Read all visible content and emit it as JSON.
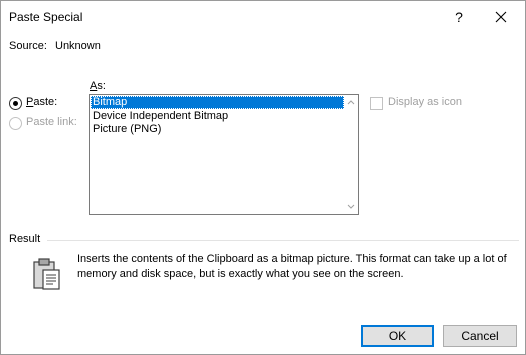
{
  "window": {
    "title": "Paste Special"
  },
  "titlebar": {
    "help_label": "?",
    "close_icon": "close-icon"
  },
  "source": {
    "label": "Source:",
    "value": "Unknown"
  },
  "options": {
    "paste_label": "Paste:",
    "paste_checked": true,
    "paste_link_label": "Paste link:",
    "paste_link_enabled": false
  },
  "as": {
    "label": "As:",
    "items": [
      "Bitmap",
      "Device Independent Bitmap",
      "Picture (PNG)"
    ],
    "selected": "Bitmap"
  },
  "display_as_icon": {
    "label": "Display as icon",
    "checked": false,
    "enabled": false
  },
  "result": {
    "label": "Result",
    "icon": "clipboard-icon",
    "text": "Inserts the contents of the Clipboard as a bitmap picture. This format can take up a lot of memory and disk space, but is exactly what you see on the screen."
  },
  "buttons": {
    "ok": "OK",
    "cancel": "Cancel"
  },
  "colors": {
    "selection": "#0078d7",
    "disabled_text": "#a0a0a0",
    "button_face": "#e1e1e1"
  }
}
